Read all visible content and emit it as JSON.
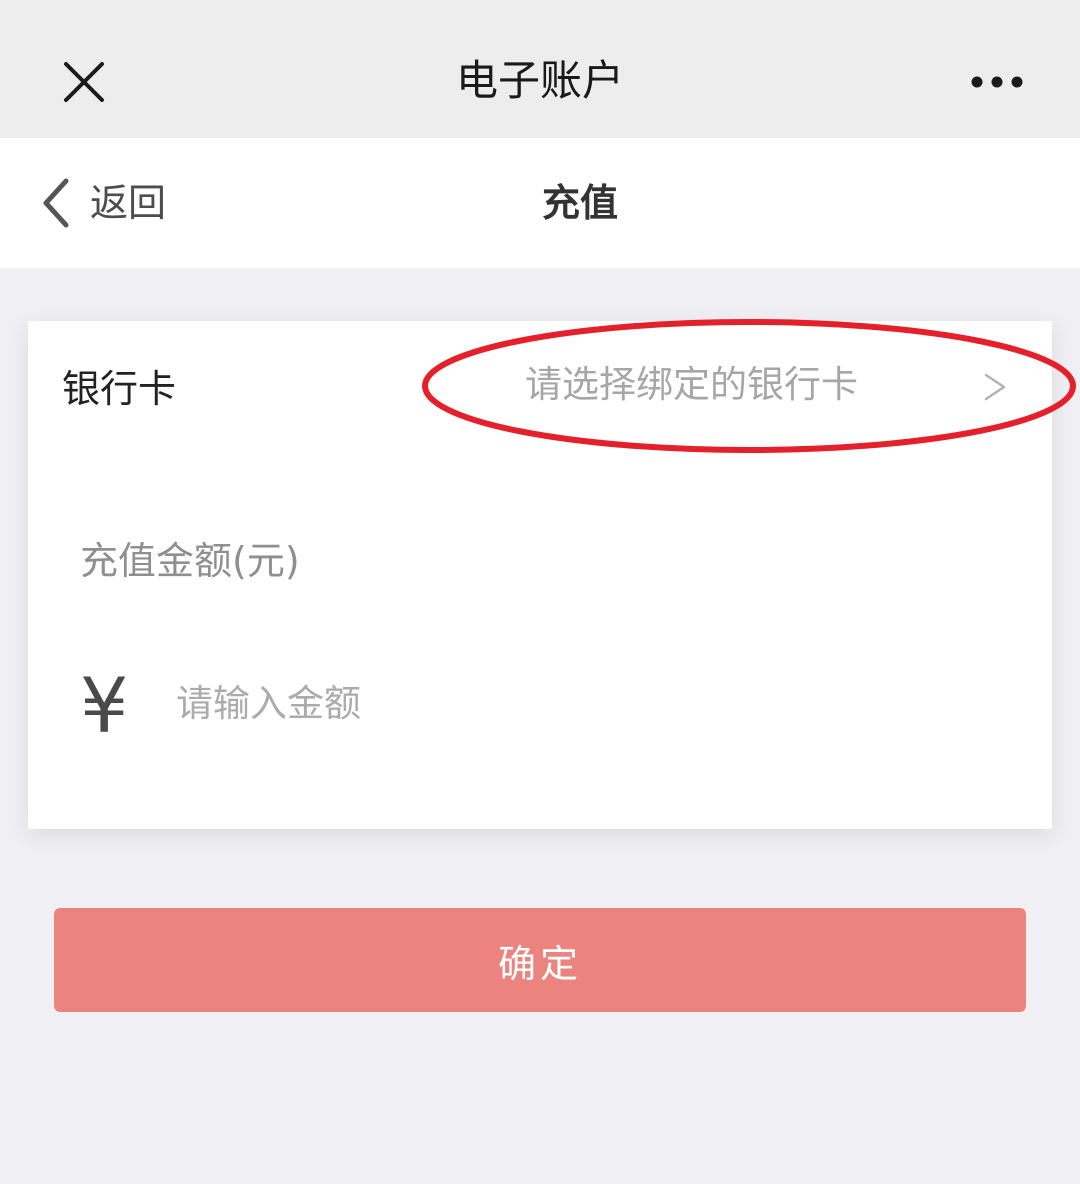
{
  "titlebar": {
    "title": "电子账户",
    "close_icon": "close-icon",
    "more_icon": "more-dots-icon"
  },
  "navbar": {
    "back_label": "返回",
    "back_icon": "chevron-left-icon",
    "page_title": "充值"
  },
  "form": {
    "bank_card_label": "银行卡",
    "bank_card_placeholder": "请选择绑定的银行卡",
    "bank_card_chevron": ">",
    "amount_label": "充值金额(元)",
    "currency_symbol": "¥",
    "amount_placeholder": "请输入金额",
    "amount_value": ""
  },
  "actions": {
    "confirm_label": "确定"
  },
  "colors": {
    "background": "#efeff4",
    "titlebar_bg": "#ededed",
    "confirm_bg": "#eb837e",
    "annotation_red": "#e4202a"
  }
}
